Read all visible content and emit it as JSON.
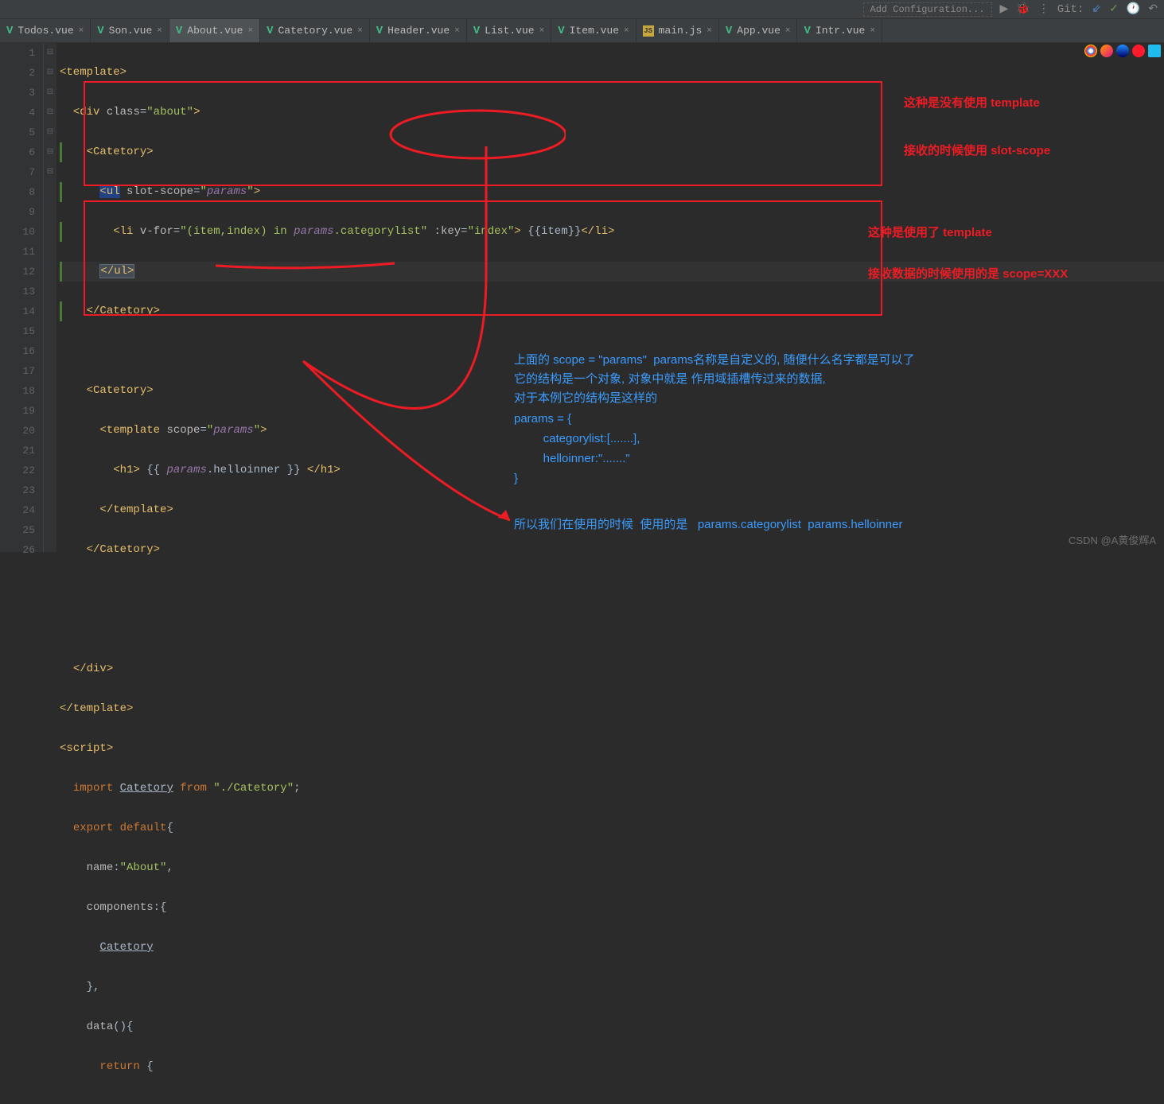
{
  "toolbar": {
    "addConfig": "Add Configuration...",
    "git": "Git:"
  },
  "tabs": [
    {
      "label": "Todos.vue",
      "icon": "vue",
      "active": false
    },
    {
      "label": "Son.vue",
      "icon": "vue",
      "active": false
    },
    {
      "label": "About.vue",
      "icon": "vue",
      "active": true
    },
    {
      "label": "Catetory.vue",
      "icon": "vue",
      "active": false
    },
    {
      "label": "Header.vue",
      "icon": "vue",
      "active": false
    },
    {
      "label": "List.vue",
      "icon": "vue",
      "active": false
    },
    {
      "label": "Item.vue",
      "icon": "vue",
      "active": false
    },
    {
      "label": "main.js",
      "icon": "js",
      "active": false
    },
    {
      "label": "App.vue",
      "icon": "vue",
      "active": false
    },
    {
      "label": "Intr.vue",
      "icon": "vue",
      "active": false
    }
  ],
  "lines": [
    "1",
    "2",
    "3",
    "4",
    "5",
    "6",
    "7",
    "8",
    "9",
    "10",
    "11",
    "12",
    "13",
    "14",
    "15",
    "16",
    "17",
    "18",
    "19",
    "20",
    "21",
    "22",
    "23",
    "24",
    "25",
    "26"
  ],
  "code": {
    "l1": {
      "tag": "template"
    },
    "l2": {
      "tag": "div",
      "attr": "class",
      "val": "\"about\""
    },
    "l3": {
      "tag": "Catetory"
    },
    "l4": {
      "tag": "ul",
      "attr": "slot-scope",
      "val": "\"",
      "ident": "params",
      "vend": "\""
    },
    "l5": {
      "tag": "li",
      "a1": "v-for",
      "v1": "\"(item,index) in ",
      "id1": "params",
      "v1b": ".categorylist\"",
      "a2": ":key",
      "v2": "\"index\"",
      "txt": " {{item}}",
      "close": "li"
    },
    "l6": {
      "tag": "/ul"
    },
    "l7": {
      "tag": "/Catetory"
    },
    "l9": {
      "tag": "Catetory"
    },
    "l10": {
      "tag": "template",
      "attr": "scope",
      "val": "\"",
      "ident": "params",
      "vend": "\""
    },
    "l11": {
      "tag": "h1",
      "txt1": " {{ ",
      "ident": "params",
      "txt2": ".helloinner }} ",
      "close": "h1"
    },
    "l12": {
      "tag": "/template"
    },
    "l13": {
      "tag": "/Catetory"
    },
    "l16": {
      "tag": "/div"
    },
    "l17": {
      "tag": "/template"
    },
    "l18": {
      "tag": "script"
    },
    "l19": {
      "kw1": "import",
      "id": "Catetory",
      "kw2": "from",
      "str": "\"./Catetory\"",
      "semi": ";"
    },
    "l20": {
      "kw1": "export",
      "kw2": "default",
      "brace": "{"
    },
    "l21": {
      "key": "name",
      "val": "\"About\"",
      "comma": ","
    },
    "l22": {
      "key": "components",
      "brace": ":{"
    },
    "l23": {
      "id": "Catetory"
    },
    "l24": {
      "brace": "},"
    },
    "l25": {
      "key": "data",
      "paren": "(){"
    },
    "l26": {
      "kw": "return",
      "brace": "{"
    }
  },
  "annotations": {
    "r1a": "这种是没有使用 template",
    "r1b": "接收的时候使用 slot-scope",
    "r2a": "这种是使用了 template",
    "r2b": "接收数据的时候使用的是 scope=XXX",
    "b1": "上面的 scope = \"params\"  params名称是自定义的, 随便什么名字都是可以了",
    "b2": "它的结构是一个对象, 对象中就是 作用域插槽传过来的数据,",
    "b3": "对于本例它的结构是这样的",
    "b4": "params = {",
    "b5": "    categorylist:[.......],",
    "b6": "    helloinner:\".......\"",
    "b7": "}",
    "b8": "所以我们在使用的时候  使用的是   params.categorylist  params.helloinner"
  },
  "watermark": "CSDN @A黄俊辉A"
}
